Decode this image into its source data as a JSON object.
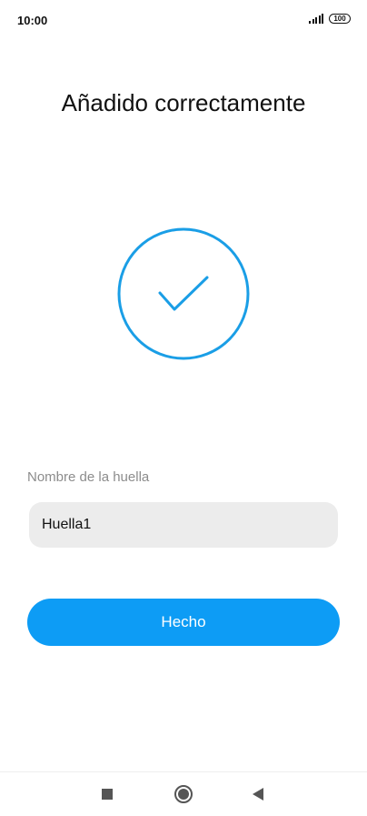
{
  "status_bar": {
    "time": "10:00",
    "battery": "100"
  },
  "header": {
    "title": "Añadido correctamente"
  },
  "success_icon": {
    "name": "checkmark-circle-icon",
    "color": "#1a9ee6"
  },
  "fingerprint_name": {
    "label": "Nombre de la huella",
    "value": "Huella1"
  },
  "actions": {
    "done_label": "Hecho",
    "done_color": "#0d9cf5"
  },
  "nav_bar": {
    "items": [
      "square-recents-icon",
      "circle-home-icon",
      "triangle-back-icon"
    ]
  }
}
